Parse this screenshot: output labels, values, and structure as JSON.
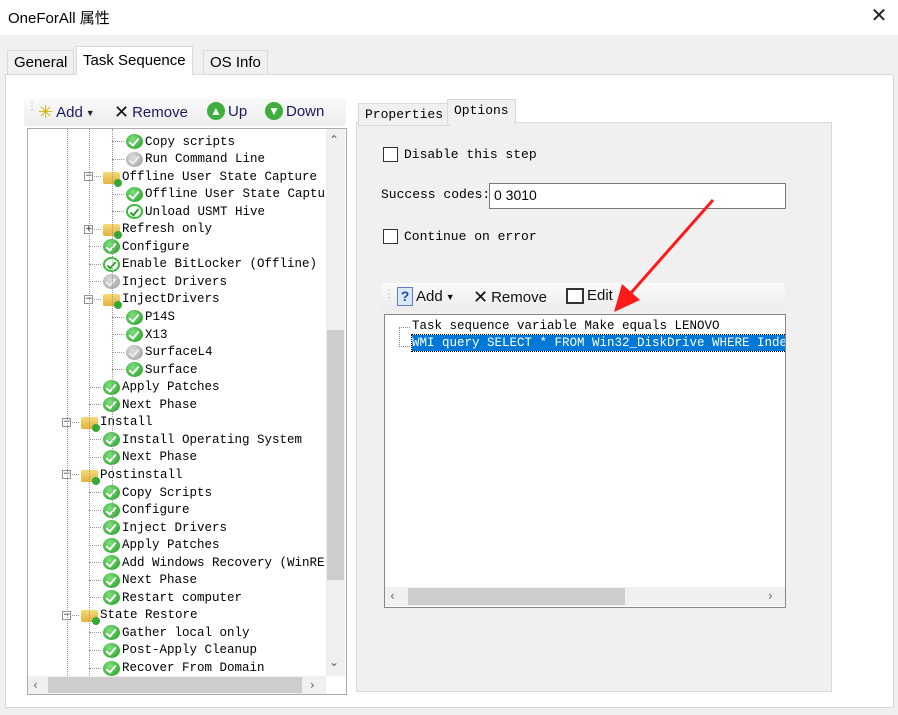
{
  "window": {
    "title": "OneForAll 属性",
    "close": "✕"
  },
  "tabs": [
    {
      "label": "General"
    },
    {
      "label": "Task Sequence",
      "selected": true
    },
    {
      "label": "OS Info"
    }
  ],
  "left_toolbar": {
    "add": "Add",
    "remove": "Remove",
    "up": "Up",
    "down": "Down"
  },
  "tree": [
    {
      "label": "Copy scripts",
      "level": 3,
      "icon": "green-check"
    },
    {
      "label": "Run Command Line",
      "level": 3,
      "icon": "gray-check"
    },
    {
      "label": "Offline User State Capture",
      "level": 2,
      "icon": "folder",
      "expander": "minus"
    },
    {
      "label": "Offline User State Captu",
      "level": 3,
      "icon": "green-check"
    },
    {
      "label": "Unload USMT Hive",
      "level": 3,
      "icon": "light-check"
    },
    {
      "label": "Refresh only",
      "level": 2,
      "icon": "folder",
      "expander": "plus"
    },
    {
      "label": "Configure",
      "level": 2,
      "icon": "green-check"
    },
    {
      "label": "Enable BitLocker (Offline)",
      "level": 2,
      "icon": "light-check"
    },
    {
      "label": "Inject Drivers",
      "level": 2,
      "icon": "gray-check"
    },
    {
      "label": "InjectDrivers",
      "level": 2,
      "icon": "folder",
      "expander": "minus"
    },
    {
      "label": "P14S",
      "level": 3,
      "icon": "green-check"
    },
    {
      "label": "X13",
      "level": 3,
      "icon": "green-check"
    },
    {
      "label": "SurfaceL4",
      "level": 3,
      "icon": "gray-check"
    },
    {
      "label": "Surface",
      "level": 3,
      "icon": "green-check"
    },
    {
      "label": "Apply Patches",
      "level": 2,
      "icon": "green-check"
    },
    {
      "label": "Next Phase",
      "level": 2,
      "icon": "green-check"
    },
    {
      "label": "Install",
      "level": 1,
      "icon": "folder",
      "expander": "minus"
    },
    {
      "label": "Install Operating System",
      "level": 2,
      "icon": "green-check"
    },
    {
      "label": "Next Phase",
      "level": 2,
      "icon": "green-check"
    },
    {
      "label": "Postinstall",
      "level": 1,
      "icon": "folder",
      "expander": "minus"
    },
    {
      "label": "Copy Scripts",
      "level": 2,
      "icon": "green-check"
    },
    {
      "label": "Configure",
      "level": 2,
      "icon": "green-check"
    },
    {
      "label": "Inject Drivers",
      "level": 2,
      "icon": "green-check"
    },
    {
      "label": "Apply Patches",
      "level": 2,
      "icon": "green-check"
    },
    {
      "label": "Add Windows Recovery (WinRE",
      "level": 2,
      "icon": "green-check"
    },
    {
      "label": "Next Phase",
      "level": 2,
      "icon": "green-check"
    },
    {
      "label": "Restart computer",
      "level": 2,
      "icon": "green-check"
    },
    {
      "label": "State Restore",
      "level": 1,
      "icon": "folder",
      "expander": "minus"
    },
    {
      "label": "Gather local only",
      "level": 2,
      "icon": "green-check"
    },
    {
      "label": "Post-Apply Cleanup",
      "level": 2,
      "icon": "green-check"
    },
    {
      "label": "Recover From Domain",
      "level": 2,
      "icon": "green-check"
    }
  ],
  "inner_tabs": [
    {
      "label": "Properties"
    },
    {
      "label": "Options",
      "selected": true
    }
  ],
  "options": {
    "disable_step": {
      "label": "Disable this step",
      "checked": false
    },
    "success_codes": {
      "label": "Success codes:",
      "value": "0 3010"
    },
    "continue_on_error": {
      "label": "Continue on error",
      "checked": false
    }
  },
  "cond_toolbar": {
    "add": "Add",
    "remove": "Remove",
    "edit": "Edit"
  },
  "conditions": [
    {
      "label": "Task sequence variable Make equals LENOVO",
      "selected": false
    },
    {
      "label": "WMI query SELECT * FROM Win32_DiskDrive WHERE Inde",
      "selected": true
    }
  ],
  "colors": {
    "selection": "#0078d7",
    "annotation_arrow": "#ff1a1a"
  }
}
